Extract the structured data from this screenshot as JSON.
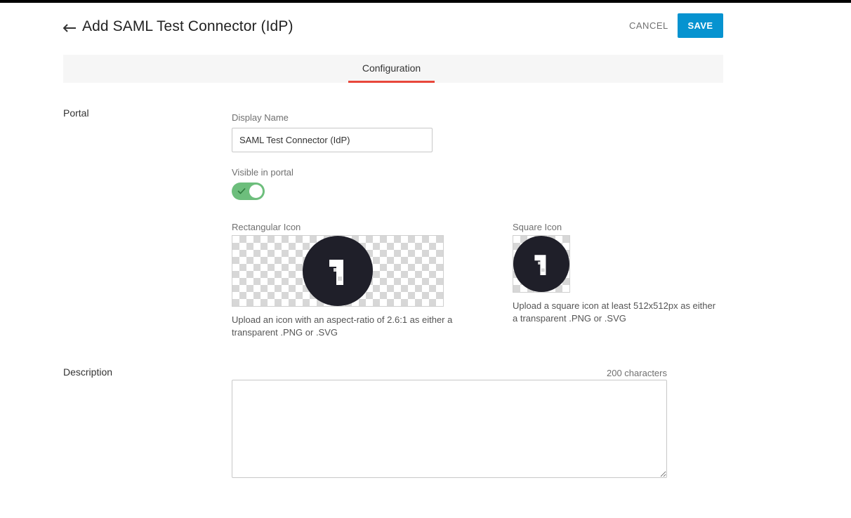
{
  "header": {
    "title": "Add SAML Test Connector (IdP)",
    "back_icon": "arrow-left-icon",
    "cancel_label": "CANCEL",
    "save_label": "SAVE"
  },
  "tabs": [
    {
      "label": "Configuration",
      "active": true
    }
  ],
  "portal": {
    "section_label": "Portal",
    "display_name_label": "Display Name",
    "display_name_value": "SAML Test Connector (IdP)",
    "visible_label": "Visible in portal",
    "visible_on": true,
    "rect_icon_label": "Rectangular Icon",
    "rect_icon_help": "Upload an icon with an aspect-ratio of 2.6:1 as either a transparent .PNG or .SVG",
    "square_icon_label": "Square Icon",
    "square_icon_help": "Upload a square icon at least 512x512px as either a transparent .PNG or .SVG"
  },
  "description": {
    "section_label": "Description",
    "char_count": "200 characters",
    "value": ""
  },
  "colors": {
    "accent": "#0693d0",
    "tab_underline": "#e8473b",
    "toggle_on": "#6dbe7c",
    "logo_dark": "#1f1f29"
  }
}
